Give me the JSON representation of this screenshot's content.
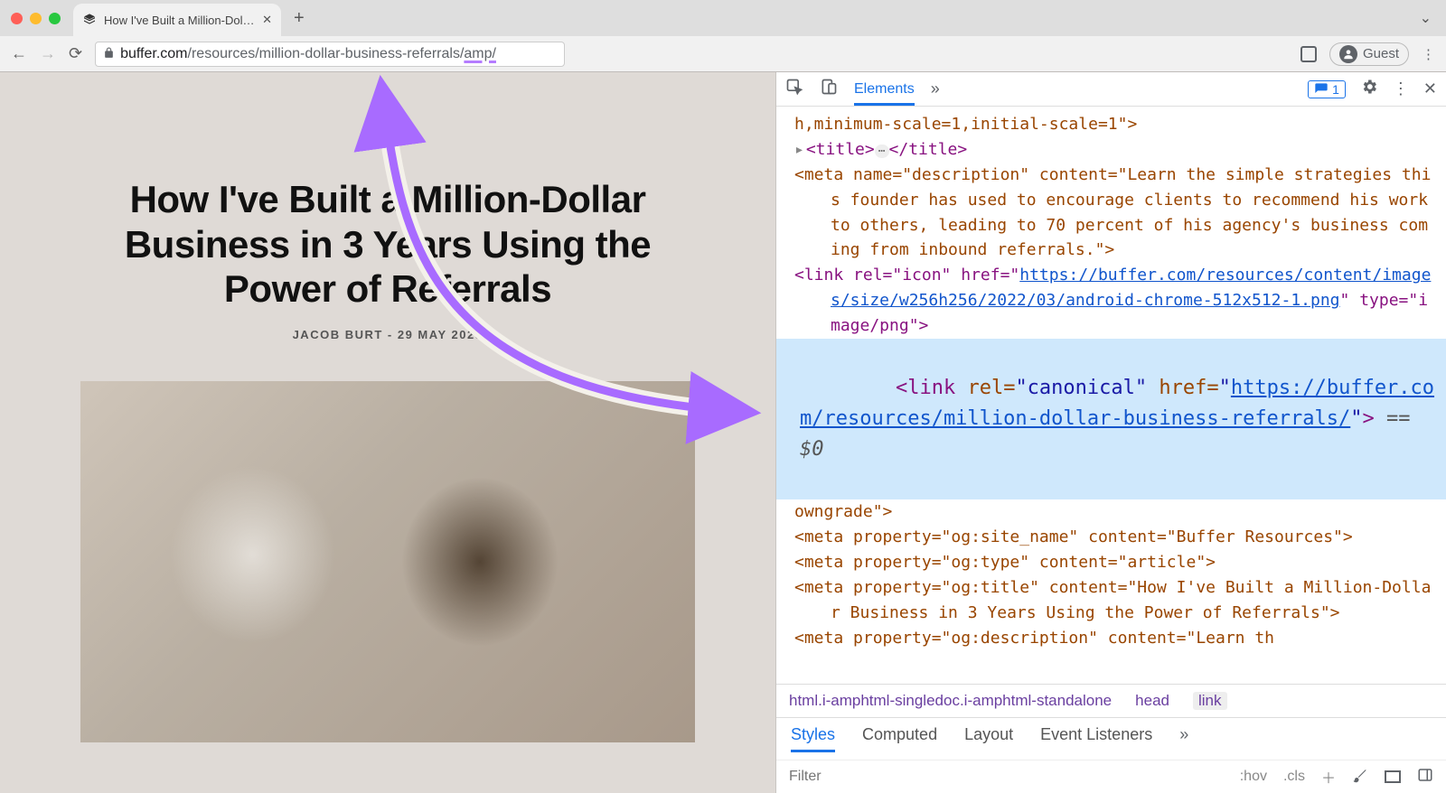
{
  "browser": {
    "tab": {
      "title": "How I've Built a Million-Dollar B",
      "favicon_name": "buffer-logo"
    },
    "url_host": "buffer.com",
    "url_path": "/resources/million-dollar-business-referrals/",
    "url_amp": "amp/",
    "guest_label": "Guest"
  },
  "article": {
    "headline": "How I've Built a Million-Dollar Business in 3 Years Using the Power of Referrals",
    "byline": "JACOB BURT - 29 MAY 2023"
  },
  "devtools": {
    "tabs": {
      "elements": "Elements",
      "issues_count": "1"
    },
    "styles_tabs": {
      "styles": "Styles",
      "computed": "Computed",
      "layout": "Layout",
      "event_listeners": "Event Listeners"
    },
    "filter_placeholder": "Filter",
    "hov": ":hov",
    "cls": ".cls",
    "breadcrumb": {
      "root": "html.i-amphtml-singledoc.i-amphtml-standalone",
      "head": "head",
      "link": "link"
    },
    "code": {
      "viewport_tail": "h,minimum-scale=1,initial-scale=1\">",
      "title_open": "<title>",
      "title_close": "</title>",
      "meta_desc": "<meta name=\"description\" content=\"Learn the simple strategies this founder has used to encourage clients to recommend his work to others, leading to 70 percent of his agency's business coming from inbound referrals.\">",
      "link_icon_pre": "<link rel=\"icon\" href=\"",
      "link_icon_url": "https://buffer.com/resources/content/images/size/w256h256/2022/03/android-chrome-512x512-1.png",
      "link_icon_post": "\" type=\"image/png\">",
      "canonical_pre": "<link rel=\"canonical\" href=\"",
      "canonical_url": "https://buffer.com/resources/million-dollar-business-referrals/",
      "canonical_post": "\"> ",
      "sel0": "== $0",
      "meta_referrer_tail": "owngrade\">",
      "og_site": "<meta property=\"og:site_name\" content=\"Buffer Resources\">",
      "og_type": "<meta property=\"og:type\" content=\"article\">",
      "og_title": "<meta property=\"og:title\" content=\"How I've Built a Million-Dollar Business in 3 Years Using the Power of Referrals\">",
      "og_desc_partial": "<meta property=\"og:description\" content=\"Learn th"
    }
  }
}
